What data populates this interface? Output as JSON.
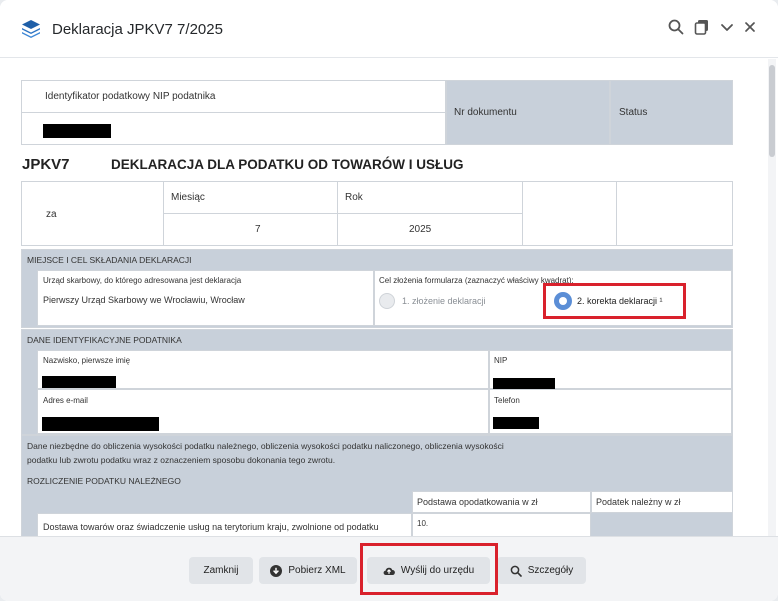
{
  "window": {
    "title": "Deklaracja JPKV7 7/2025"
  },
  "header_icons": [
    "search-icon",
    "copy-icon",
    "chevron-down-icon",
    "close-icon"
  ],
  "top": {
    "nip_label": "Identyfikator podatkowy NIP podatnika",
    "doc_number_label": "Nr dokumentu",
    "status_label": "Status"
  },
  "form": {
    "code": "JPKV7",
    "heading": "DEKLARACJA DLA PODATKU OD TOWARÓW I USŁUG",
    "za_label": "za",
    "month_label": "Miesiąc",
    "month_value": "7",
    "year_label": "Rok",
    "year_value": "2025"
  },
  "section_place": {
    "title": "MIEJSCE I CEL SKŁADANIA DEKLARACJI",
    "office_label": "Urząd skarbowy, do którego adresowana jest deklaracja",
    "office_value": "Pierwszy Urząd Skarbowy we Wrocławiu, Wrocław",
    "purpose_label": "Cel złożenia formularza (zaznaczyć właściwy kwadrat):",
    "option1": "1. złożenie deklaracji",
    "option2": "2. korekta deklaracji ¹",
    "selected_option": "2"
  },
  "section_id": {
    "title": "DANE IDENTYFIKACYJNE PODATNIKA",
    "name_label": "Nazwisko, pierwsze imię",
    "nip_label": "NIP",
    "email_label": "Adres e-mail",
    "phone_label": "Telefon"
  },
  "section_calc": {
    "intro_line1": "Dane niezbędne do obliczenia wysokości podatku należnego, obliczenia wysokości podatku naliczonego, obliczenia wysokości",
    "intro_line2": "podatku lub zwrotu podatku wraz z oznaczeniem sposobu dokonania tego zwrotu.",
    "subtitle": "ROZLICZENIE PODATKU NALEŻNEGO",
    "col_base": "Podstawa opodatkowania w zł",
    "col_tax": "Podatek należny w zł",
    "row1_label": "Dostawa towarów oraz świadczenie usług na terytorium kraju, zwolnione od podatku",
    "row1_number": "10."
  },
  "footer": {
    "close": "Zamknij",
    "download_xml": "Pobierz XML",
    "send": "Wyślij do urzędu",
    "details": "Szczegóły"
  },
  "colors": {
    "highlight": "#d9212c",
    "section_grey": "#c8d0da",
    "accent_radio": "#5b8ed6"
  }
}
